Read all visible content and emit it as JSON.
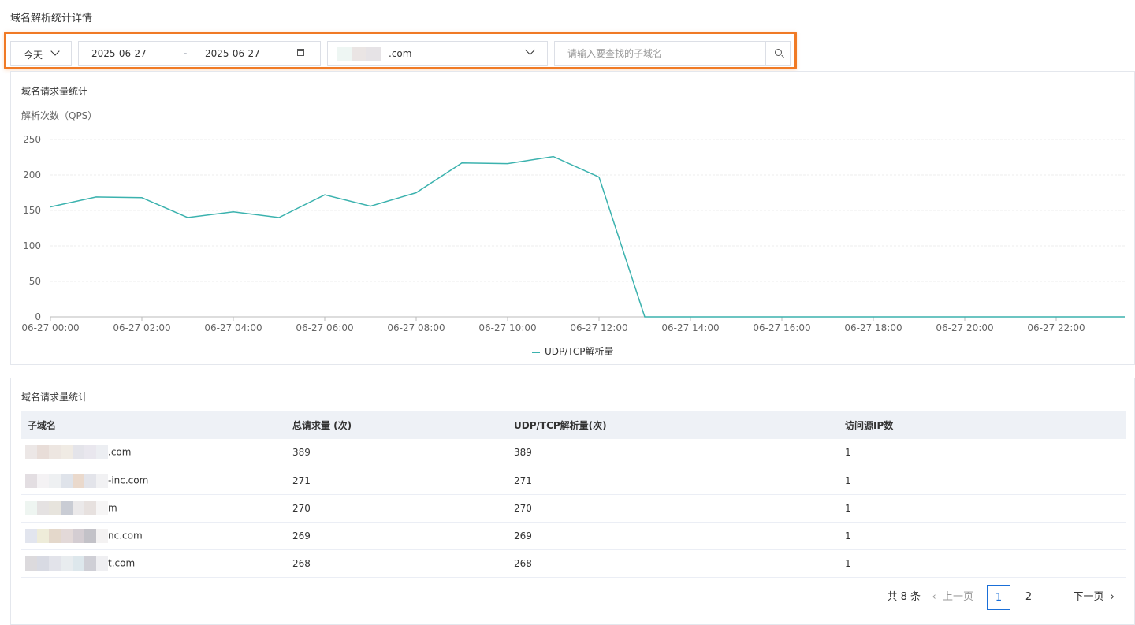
{
  "page": {
    "title": "域名解析统计详情"
  },
  "filters": {
    "period": "今天",
    "date_start": "2025-06-27",
    "date_sep": "-",
    "date_end": "2025-06-27",
    "domain_suffix": ".com",
    "search_placeholder": "请输入要查找的子域名"
  },
  "chart_panel": {
    "title": "域名请求量统计",
    "ylabel": "解析次数（QPS）",
    "legend": "UDP/TCP解析量"
  },
  "chart_data": {
    "type": "line",
    "title": "域名请求量统计",
    "ylabel": "解析次数（QPS）",
    "xlabel": "",
    "ylim": [
      0,
      250
    ],
    "yticks": [
      0,
      50,
      100,
      150,
      200,
      250
    ],
    "x_tick_labels": [
      "06-27 00:00",
      "06-27 02:00",
      "06-27 04:00",
      "06-27 06:00",
      "06-27 08:00",
      "06-27 10:00",
      "06-27 12:00",
      "06-27 14:00",
      "06-27 16:00",
      "06-27 18:00",
      "06-27 20:00",
      "06-27 22:00"
    ],
    "grid": true,
    "legend_position": "bottom",
    "series": [
      {
        "name": "UDP/TCP解析量",
        "color": "#3bb2ae",
        "x_hours": [
          0,
          1,
          2,
          3,
          4,
          5,
          6,
          7,
          8,
          9,
          10,
          11,
          12,
          13,
          14,
          15,
          16,
          17,
          18,
          19,
          20,
          21,
          22,
          23
        ],
        "values": [
          155,
          169,
          168,
          140,
          148,
          140,
          172,
          156,
          175,
          217,
          216,
          226,
          197,
          0,
          0,
          0,
          0,
          0,
          0,
          0,
          0,
          0,
          0,
          0
        ]
      }
    ]
  },
  "table_panel": {
    "title": "域名请求量统计",
    "columns": [
      "子域名",
      "总请求量 (次)",
      "UDP/TCP解析量(次)",
      "访问源IP数"
    ],
    "rows": [
      {
        "domain_visible": ".com",
        "total": "389",
        "udp_tcp": "389",
        "ips": "1"
      },
      {
        "domain_visible": "-inc.com",
        "total": "271",
        "udp_tcp": "271",
        "ips": "1"
      },
      {
        "domain_visible": "m",
        "total": "270",
        "udp_tcp": "270",
        "ips": "1"
      },
      {
        "domain_visible": "nc.com",
        "total": "269",
        "udp_tcp": "269",
        "ips": "1"
      },
      {
        "domain_visible": "t.com",
        "total": "268",
        "udp_tcp": "268",
        "ips": "1"
      }
    ]
  },
  "pagination": {
    "total": "共 8 条",
    "prev": "上一页",
    "pages": [
      "1",
      "2"
    ],
    "current": "1",
    "next": "下一页"
  }
}
